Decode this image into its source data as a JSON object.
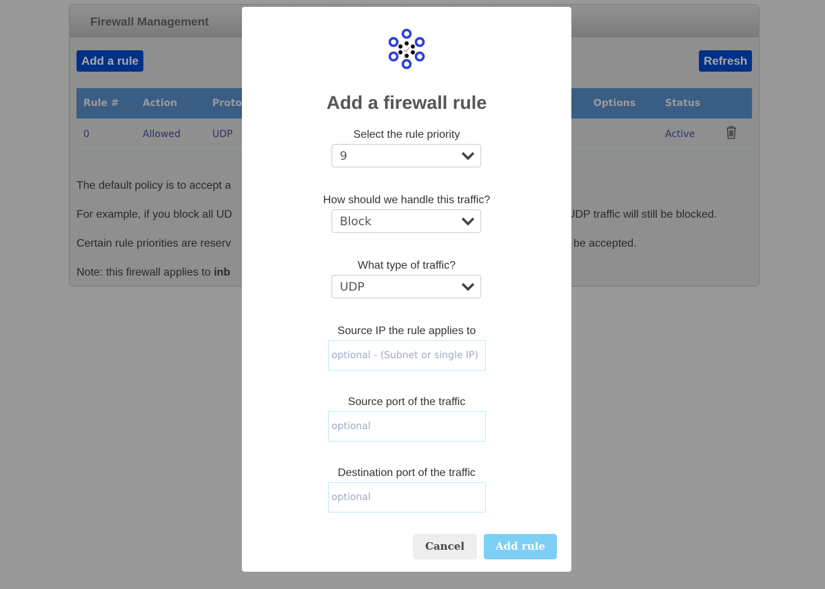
{
  "panel": {
    "title": "Firewall Management",
    "add_rule": "Add a rule",
    "refresh": "Refresh"
  },
  "table": {
    "headers": [
      "Rule #",
      "Action",
      "Protoc",
      "Options",
      "Status"
    ],
    "rows": [
      {
        "rule": "0",
        "action": "Allowed",
        "protocol": "UDP",
        "status": "Active"
      }
    ]
  },
  "notes": [
    "The default policy is to accept a",
    "For example, if you block all UD",
    "UDP traffic will still be blocked.",
    "Certain rule priorities are reserv",
    "be accepted.",
    "Note: this firewall applies to ",
    "inb"
  ],
  "modal": {
    "title": "Add a firewall rule",
    "priority_label": "Select the rule priority",
    "priority_value": "9",
    "handle_label": "How should we handle this traffic?",
    "handle_value": "Block",
    "type_label": "What type of traffic?",
    "type_value": "UDP",
    "src_ip_label": "Source IP the rule applies to",
    "src_ip_placeholder": "optional - (Subnet or single IP)",
    "src_port_label": "Source port of the traffic",
    "src_port_placeholder": "optional",
    "dst_port_label": "Destination port of the traffic",
    "dst_port_placeholder": "optional",
    "cancel": "Cancel",
    "submit": "Add rule"
  },
  "colors": {
    "brand_blue": "#003087",
    "ring_blue": "#2b3fd8",
    "submit": "#7dcff5"
  }
}
